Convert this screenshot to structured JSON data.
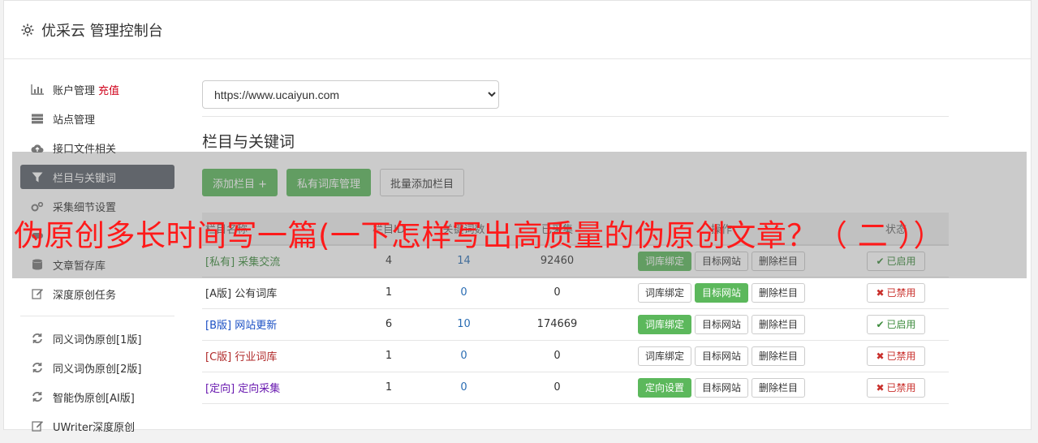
{
  "app": {
    "title": "优采云 管理控制台",
    "icon": "gear-icon"
  },
  "sidebar": {
    "items": [
      {
        "label": "账户管理",
        "extra": "充值",
        "icon": "bar-chart-icon"
      },
      {
        "label": "站点管理",
        "icon": "server-icon"
      },
      {
        "label": "接口文件相关",
        "icon": "cloud-upload-icon"
      },
      {
        "label": "栏目与关键词",
        "icon": "filter-icon",
        "active": true
      },
      {
        "label": "采集细节设置",
        "icon": "gears-icon"
      },
      {
        "label": "",
        "icon": "toggle-icon"
      },
      {
        "label": "文章暂存库",
        "icon": "database-icon"
      },
      {
        "label": "深度原创任务",
        "icon": "edit-icon"
      }
    ],
    "tools": [
      {
        "label": "同义词伪原创[1版]",
        "icon": "refresh-icon"
      },
      {
        "label": "同义词伪原创[2版]",
        "icon": "refresh-icon"
      },
      {
        "label": "智能伪原创[AI版]",
        "icon": "refresh-icon"
      },
      {
        "label": "UWriter深度原创",
        "icon": "edit-icon"
      }
    ]
  },
  "main": {
    "site_select": {
      "value": "https://www.ucaiyun.com"
    },
    "section_title": "栏目与关键词",
    "buttons": {
      "add": "添加栏目 +",
      "private": "私有词库管理",
      "batch": "批量添加栏目"
    },
    "table": {
      "headers": [
        "栏目名称",
        "栏目ID",
        "关键词数",
        "已采集",
        "操作",
        "状态"
      ],
      "rows": [
        {
          "tag": "[私有]",
          "name": "采集交流",
          "tag_color": "green",
          "id": "4",
          "keywords": "14",
          "collected": "92460",
          "op1": "词库绑定",
          "op1_on": true,
          "op2": "目标网站",
          "op2_on": false,
          "op3": "删除栏目",
          "status": "已启用",
          "status_type": "enabled"
        },
        {
          "tag": "[A版]",
          "name": "公有词库",
          "tag_color": "black",
          "id": "1",
          "keywords": "0",
          "collected": "0",
          "op1": "词库绑定",
          "op1_on": false,
          "op2": "目标网站",
          "op2_on": true,
          "op3": "删除栏目",
          "status": "已禁用",
          "status_type": "disabled"
        },
        {
          "tag": "[B版]",
          "name": "网站更新",
          "tag_color": "blue",
          "id": "6",
          "keywords": "10",
          "collected": "174669",
          "op1": "词库绑定",
          "op1_on": true,
          "op2": "目标网站",
          "op2_on": false,
          "op3": "删除栏目",
          "status": "已启用",
          "status_type": "enabled"
        },
        {
          "tag": "[C版]",
          "name": "行业词库",
          "tag_color": "red",
          "id": "1",
          "keywords": "0",
          "collected": "0",
          "op1": "词库绑定",
          "op1_on": false,
          "op2": "目标网站",
          "op2_on": false,
          "op3": "删除栏目",
          "status": "已禁用",
          "status_type": "disabled"
        },
        {
          "tag": "[定向]",
          "name": "定向采集",
          "tag_color": "purple",
          "id": "1",
          "keywords": "0",
          "collected": "0",
          "op1": "定向设置",
          "op1_on": true,
          "op2": "目标网站",
          "op2_on": false,
          "op3": "删除栏目",
          "status": "已禁用",
          "status_type": "disabled"
        }
      ]
    }
  },
  "overlay": {
    "headline": "伪原创多长时间写一篇(一下怎样写出高质量的伪原创文章？（ 二 ））"
  },
  "colors": {
    "accent_green": "#5cb85c",
    "sidebar_active": "#5a6069",
    "headline_red": "#ff1a1a",
    "danger": "#c9302c"
  }
}
